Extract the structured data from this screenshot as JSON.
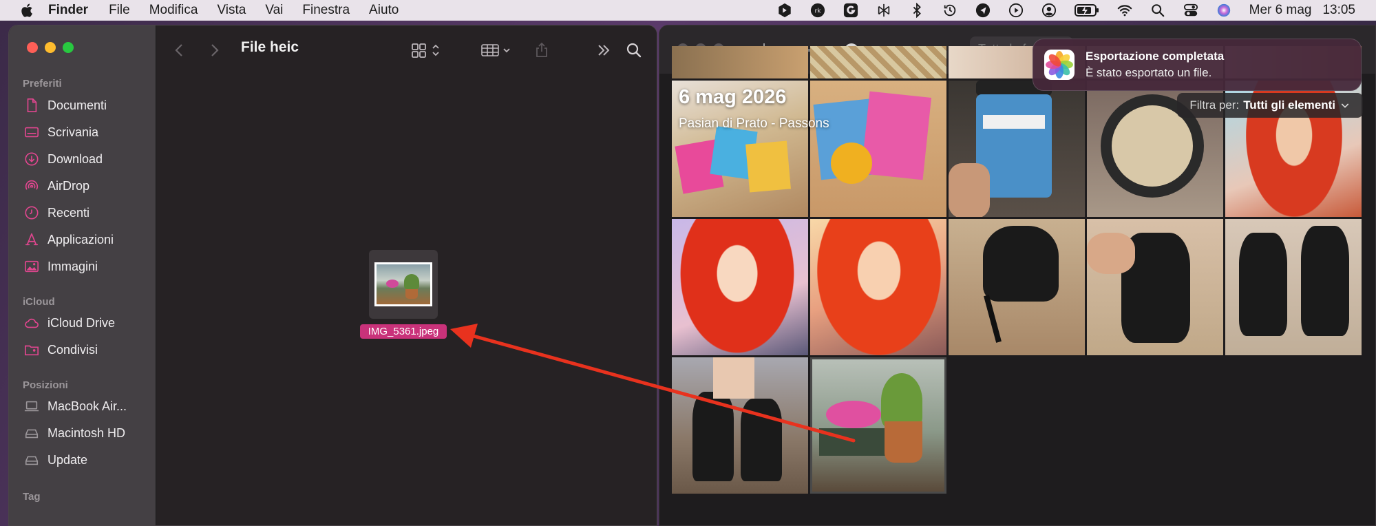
{
  "menubar": {
    "app_name": "Finder",
    "items": [
      "File",
      "Modifica",
      "Vista",
      "Vai",
      "Finestra",
      "Aiuto"
    ],
    "date": "Mer 6 mag",
    "time": "13:05"
  },
  "finder": {
    "folder_title": "File heic",
    "sidebar": {
      "favorites_header": "Preferiti",
      "favorites": [
        "Documenti",
        "Scrivania",
        "Download",
        "AirDrop",
        "Recenti",
        "Applicazioni",
        "Immagini"
      ],
      "icloud_header": "iCloud",
      "icloud": [
        "iCloud Drive",
        "Condivisi"
      ],
      "locations_header": "Posizioni",
      "locations": [
        "MacBook Air...",
        "Macintosh HD",
        "Update"
      ],
      "tags_header": "Tag"
    },
    "file": {
      "name": "IMG_5361.jpeg"
    }
  },
  "photos": {
    "search_placeholder": "Tutte le fo",
    "date_heading": "6 mag 2026",
    "place_heading": "Pasian di Prato - Passons",
    "filter_label": "Filtra per:",
    "filter_value": "Tutti gli elementi",
    "zoom_minus": "−",
    "zoom_plus": "+"
  },
  "notification": {
    "title": "Esportazione completata",
    "body": "È stato esportato un file."
  },
  "colors": {
    "accent_pink": "#c9327a",
    "arrow_red": "#e8321e"
  }
}
